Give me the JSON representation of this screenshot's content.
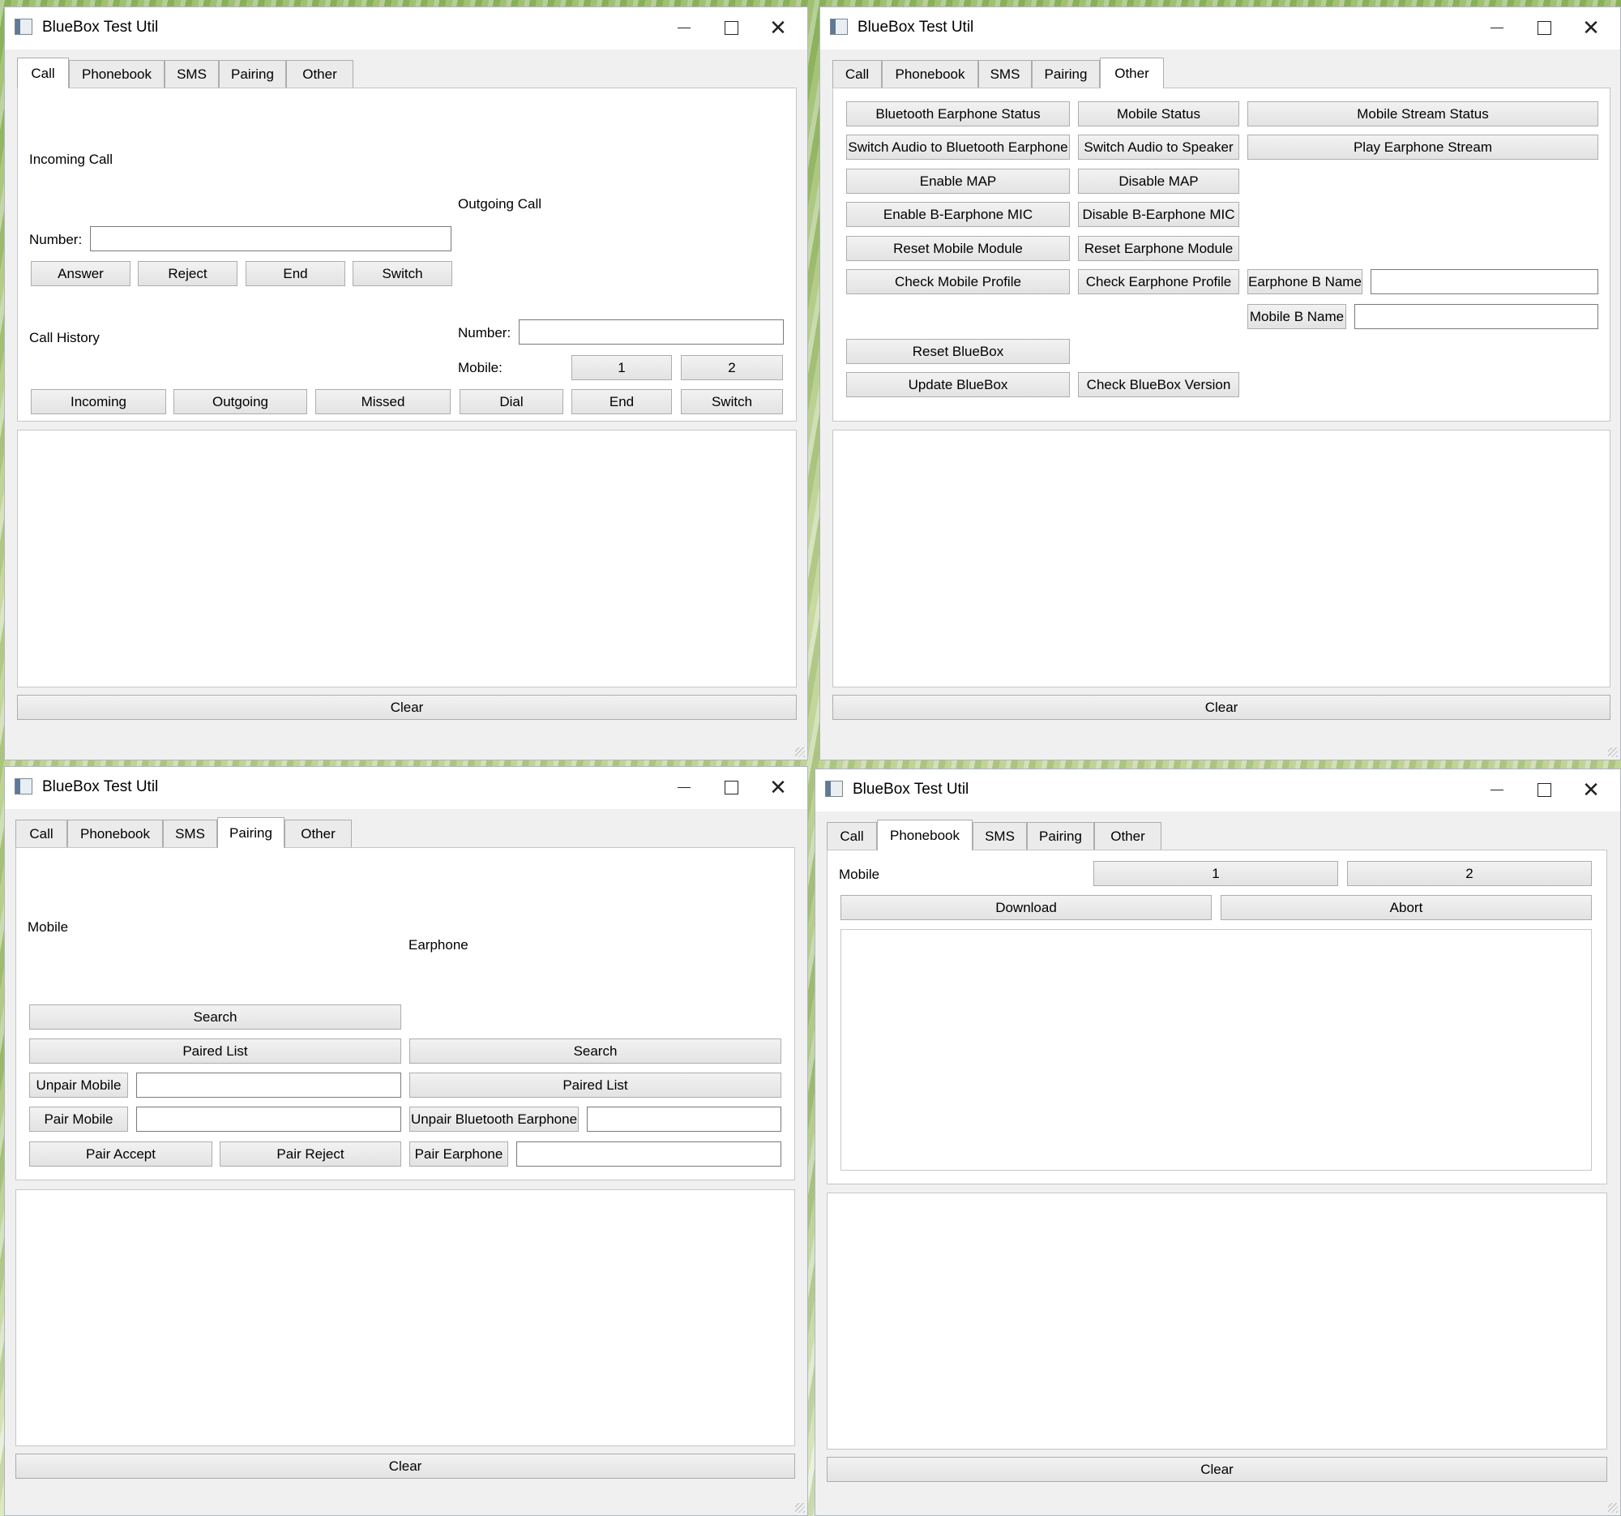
{
  "app_title": "BlueBox Test Util",
  "tabs": [
    "Call",
    "Phonebook",
    "SMS",
    "Pairing",
    "Other"
  ],
  "clear_label": "Clear",
  "call": {
    "incoming_call": "Incoming Call",
    "outgoing_call": "Outgoing Call",
    "number_label": "Number:",
    "answer": "Answer",
    "reject": "Reject",
    "end": "End",
    "switch": "Switch",
    "call_history": "Call History",
    "out_number_label": "Number:",
    "mobile_label": "Mobile:",
    "mobile_1": "1",
    "mobile_2": "2",
    "incoming": "Incoming",
    "outgoing": "Outgoing",
    "missed": "Missed",
    "dial": "Dial",
    "out_end": "End",
    "out_switch": "Switch"
  },
  "other": {
    "bt_earphone_status": "Bluetooth Earphone Status",
    "mobile_status": "Mobile Status",
    "mobile_stream_status": "Mobile Stream Status",
    "switch_audio_bt": "Switch Audio to Bluetooth Earphone",
    "switch_audio_speaker": "Switch  Audio to Speaker",
    "play_earphone_stream": "Play Earphone Stream",
    "enable_map": "Enable MAP",
    "disable_map": "Disable MAP",
    "enable_b_mic": "Enable B-Earphone MIC",
    "disable_b_mic": "Disable B-Earphone MIC",
    "reset_mobile_module": "Reset Mobile Module",
    "reset_earphone_module": "Reset Earphone Module",
    "check_mobile_profile": "Check Mobile Profile",
    "check_earphone_profile": "Check Earphone Profile",
    "earphone_b_name": "Earphone B Name",
    "mobile_b_name": "Mobile B Name",
    "reset_bluebox": "Reset BlueBox",
    "update_bluebox": "Update BlueBox",
    "check_bluebox_version": "Check BlueBox Version"
  },
  "pairing": {
    "mobile_label": "Mobile",
    "earphone_label": "Earphone",
    "search": "Search",
    "paired_list": "Paired List",
    "unpair_mobile": "Unpair Mobile",
    "pair_mobile": "Pair Mobile",
    "pair_accept": "Pair Accept",
    "pair_reject": "Pair Reject",
    "e_search": "Search",
    "e_paired_list": "Paired List",
    "unpair_bt_earphone": "Unpair Bluetooth Earphone",
    "pair_earphone": "Pair Earphone"
  },
  "phonebook": {
    "mobile_label": "Mobile",
    "mobile_1": "1",
    "mobile_2": "2",
    "download": "Download",
    "abort": "Abort"
  }
}
